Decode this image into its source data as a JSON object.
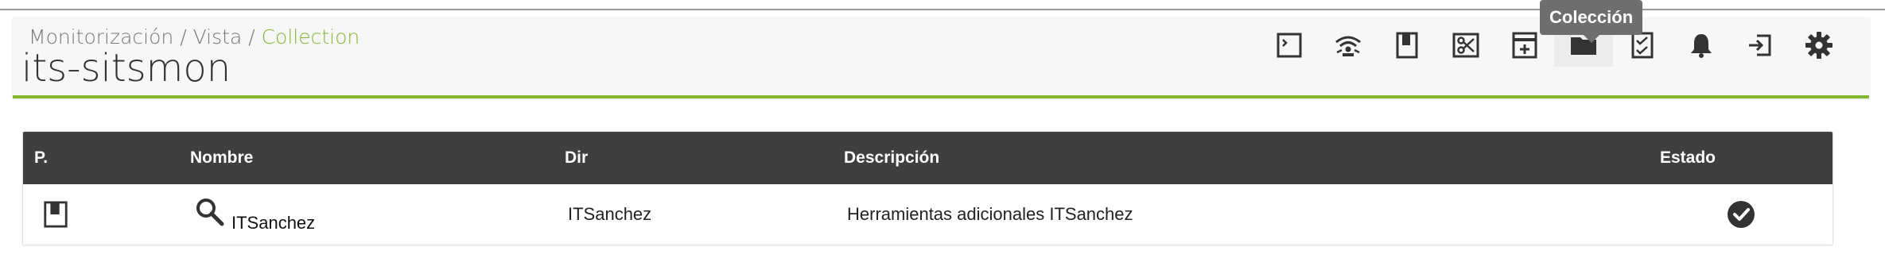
{
  "breadcrumb": {
    "part1": "Monitorización",
    "separator": " / ",
    "part2": "Vista",
    "current": "Collection"
  },
  "page_title": "its-sitsmon",
  "toolbar": {
    "tooltip": "Colección",
    "icons": [
      "console-icon",
      "wifi-monitor-icon",
      "book-icon",
      "scissors-icon",
      "printer-icon",
      "folder-icon",
      "checklist-icon",
      "bell-icon",
      "logout-icon",
      "gear-icon"
    ],
    "active_icon": "folder-icon"
  },
  "table": {
    "headers": {
      "p": "P.",
      "nombre": "Nombre",
      "dir": "Dir",
      "descripcion": "Descripción",
      "estado": "Estado"
    },
    "rows": [
      {
        "p_icon": "book-icon",
        "nombre_icon": "search-icon",
        "nombre": "ITSanchez",
        "dir": "ITSanchez",
        "descripcion": "Herramientas adicionales ITSanchez",
        "estado_icon": "check-circle-icon"
      }
    ]
  },
  "colors": {
    "accent": "#82b92e",
    "header_bg": "#3f3f3f",
    "tooltip_bg": "#6e6e6e"
  }
}
